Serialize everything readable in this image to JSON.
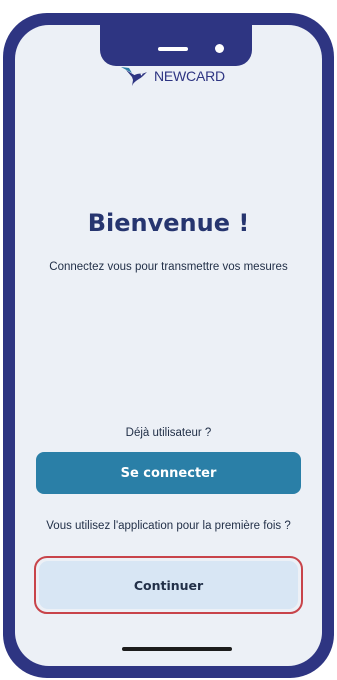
{
  "app": {
    "brand_name": "NEWCARD"
  },
  "welcome": {
    "title": "Bienvenue !",
    "subtitle": "Connectez vous pour transmettre vos mesures"
  },
  "login": {
    "prompt": "Déjà utilisateur ?",
    "button_label": "Se connecter"
  },
  "first_use": {
    "prompt": "Vous utilisez l'application  pour la première fois ?",
    "button_label": "Continuer"
  },
  "colors": {
    "frame": "#2e3582",
    "screen_background": "#ecf0f6",
    "primary_button": "#2a7fa7",
    "secondary_button": "#d8e6f4",
    "highlight_outline": "#c8444a",
    "title_text": "#26356f"
  },
  "icons": {
    "logo": "hummingbird-logo-icon"
  }
}
